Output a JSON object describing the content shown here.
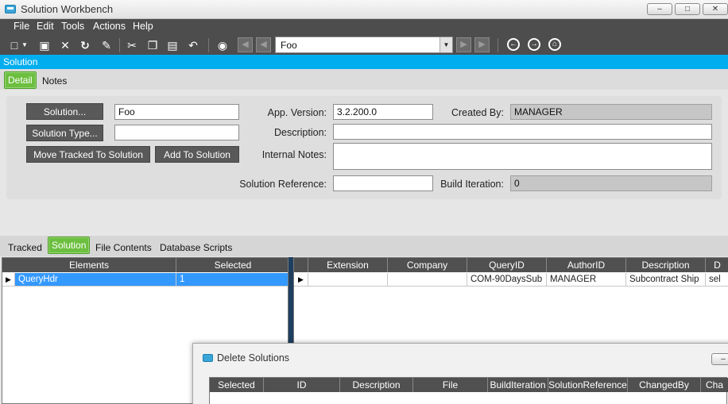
{
  "window": {
    "title": "Solution Workbench",
    "controls": [
      "–",
      "□",
      "✕"
    ]
  },
  "menu": [
    "File",
    "Edit",
    "Tools",
    "Actions",
    "Help"
  ],
  "toolbar": {
    "record_value": "Foo",
    "icons": [
      "new-icon",
      "save-icon",
      "delete-icon",
      "refresh-icon",
      "clear-icon",
      "cut-icon",
      "copy-icon",
      "paste-icon",
      "undo-icon",
      "search-icon"
    ]
  },
  "section": {
    "title": "Solution"
  },
  "tabs": {
    "top": [
      "Detail",
      "Notes"
    ],
    "lower": [
      "Tracked",
      "Solution",
      "File Contents",
      "Database Scripts"
    ]
  },
  "detail": {
    "solution_button": "Solution...",
    "solution_value": "Foo",
    "solution_type_button": "Solution Type...",
    "solution_type_value": "",
    "move_tracked_button": "Move Tracked To Solution",
    "add_to_solution_button": "Add To Solution",
    "app_version_label": "App. Version:",
    "app_version_value": "3.2.200.0",
    "created_by_label": "Created By:",
    "created_by_value": "MANAGER",
    "description_label": "Description:",
    "description_value": "",
    "internal_notes_label": "Internal Notes:",
    "internal_notes_value": "",
    "solution_reference_label": "Solution Reference:",
    "solution_reference_value": "",
    "build_iteration_label": "Build Iteration:",
    "build_iteration_value": "0"
  },
  "elements_grid": {
    "columns": [
      "Elements",
      "Selected"
    ],
    "rows": [
      [
        "QueryHdr",
        "1"
      ]
    ]
  },
  "detail_grid": {
    "columns": [
      "Extension",
      "Company",
      "QueryID",
      "AuthorID",
      "Description",
      "D"
    ],
    "rows": [
      [
        "",
        "",
        "COM-90DaysSub",
        "MANAGER",
        "Subcontract Ship",
        "sel"
      ]
    ]
  },
  "dialog": {
    "title": "Delete Solutions",
    "columns": [
      "Selected",
      "ID",
      "Description",
      "File",
      "BuildIteration",
      "SolutionReference",
      "ChangedBy",
      "Cha"
    ]
  }
}
